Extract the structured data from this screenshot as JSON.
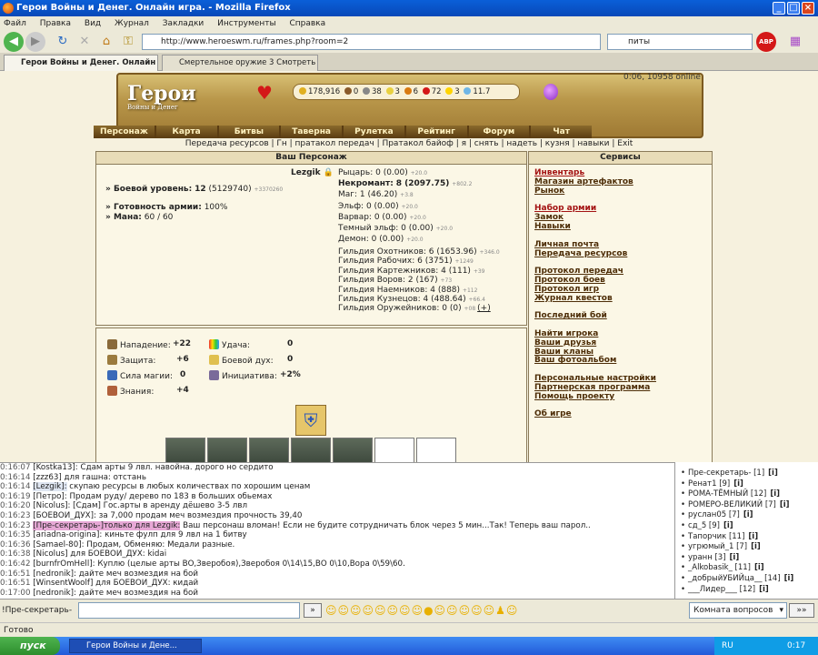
{
  "window": {
    "title": "Герои Войны и Денег. Онлайн игра. - Mozilla Firefox"
  },
  "menu": [
    "Файл",
    "Правка",
    "Вид",
    "Журнал",
    "Закладки",
    "Инструменты",
    "Справка"
  ],
  "nav": {
    "url": "http://www.heroeswm.ru/frames.php?room=2",
    "search": "питы"
  },
  "tabs": [
    "Герои Войны и Денег. Онлайн иг...",
    "Смертельное оружие 3 Смотреть Он..."
  ],
  "game": {
    "logo_title": "Герои",
    "logo_subtitle": "Войны и Денег",
    "resources": [
      "178,916",
      "0",
      "38",
      "3",
      "6",
      "72",
      "3",
      "11.7"
    ],
    "online": "0:06, 10958 online",
    "main_nav": [
      "Персонаж",
      "Карта",
      "Битвы",
      "Таверна",
      "Рулетка",
      "Рейтинг",
      "Форум",
      "Чат"
    ],
    "sub_nav": "Передача ресурсов | Гн | пратакол передач | Пратакол байоф | я | снять | надеть | кузня | навыки | Exit"
  },
  "character": {
    "panel_title": "Ваш Персонаж",
    "name": "Lezgik",
    "level_label": "» Боевой уровень:",
    "level_value": "12",
    "level_exp": "(5129740)",
    "level_bonus": "+3370260",
    "army_label": "» Готовность армии:",
    "army_value": "100%",
    "mana_label": "» Мана:",
    "mana_value": "60 / 60",
    "factions": [
      {
        "label": "Рыцарь:",
        "value": "0 (0.00)",
        "bonus": "+20.0"
      },
      {
        "label": "Некромант:",
        "value": "8 (2097.75)",
        "bonus": "+802.2"
      },
      {
        "label": "Маг:",
        "value": "1 (46.20)",
        "bonus": "+3.8"
      },
      {
        "label": "Эльф:",
        "value": "0 (0.00)",
        "bonus": "+20.0"
      },
      {
        "label": "Варвар:",
        "value": "0 (0.00)",
        "bonus": "+20.0"
      },
      {
        "label": "Темный эльф:",
        "value": "0 (0.00)",
        "bonus": "+20.0"
      },
      {
        "label": "Демон:",
        "value": "0 (0.00)",
        "bonus": "+20.0"
      }
    ],
    "guilds": [
      {
        "label": "Гильдия Охотников:",
        "value": "6 (1653.96)",
        "bonus": "+346.0"
      },
      {
        "label": "Гильдия Рабочих:",
        "value": "6 (3751)",
        "bonus": "+1249"
      },
      {
        "label": "Гильдия Картежников:",
        "value": "4 (111)",
        "bonus": "+39"
      },
      {
        "label": "Гильдия Воров:",
        "value": "2 (167)",
        "bonus": "+73"
      },
      {
        "label": "Гильдия Наемников:",
        "value": "4 (888)",
        "bonus": "+112"
      },
      {
        "label": "Гильдия Кузнецов:",
        "value": "4 (488.64)",
        "bonus": "+66.4"
      },
      {
        "label": "Гильдия Оружейников:",
        "value": "0 (0)",
        "bonus": "+08"
      }
    ],
    "guild_plus": "(+)"
  },
  "stats": [
    {
      "label": "Нападение:",
      "value": "+22",
      "icon": "sword-icon"
    },
    {
      "label": "Защита:",
      "value": "+6",
      "icon": "shield-icon"
    },
    {
      "label": "Сила магии:",
      "value": "0",
      "icon": "wand-icon"
    },
    {
      "label": "Знания:",
      "value": "+4",
      "icon": "book-icon"
    },
    {
      "label": "Удача:",
      "value": "0",
      "icon": "rainbow-icon"
    },
    {
      "label": "Боевой дух:",
      "value": "0",
      "icon": "wings-icon"
    },
    {
      "label": "Инициатива:",
      "value": "+2%",
      "icon": "hourglass-icon"
    }
  ],
  "services": {
    "title": "Сервисы",
    "groups": [
      [
        "Инвентарь",
        "Магазин артефактов",
        "Рынок"
      ],
      [
        "Набор армии",
        "Замок",
        "Навыки"
      ],
      [
        "Личная почта",
        "Передача ресурсов"
      ],
      [
        "Протокол передач",
        "Протокол боев",
        "Протокол игр",
        "Журнал квестов"
      ],
      [
        "Последний бой"
      ],
      [
        "Найти игрока",
        "Ваши друзья",
        "Ваши кланы",
        "Ваш фотоальбом"
      ],
      [
        "Персональные настройки",
        "Партнерская программа",
        "Помощь проекту"
      ],
      [
        "Об игре"
      ]
    ]
  },
  "chat": [
    {
      "time": "0:16:07",
      "nick": "[Kostka13]:",
      "text": " Сдам арты 9 лвл. навойна. дорого но сердито"
    },
    {
      "time": "0:16:14",
      "nick": "[zzz63]",
      "text": " для гашна: отстань"
    },
    {
      "time": "0:16:14",
      "nick": "[Lezgik]:",
      "text": " скупаю ресурсы в любых количествах по хорошим ценам"
    },
    {
      "time": "0:16:19",
      "nick": "[Петро]:",
      "text": " Продам руду/ дерево по 183 в больших обьемах"
    },
    {
      "time": "0:16:20",
      "nick": "[Nicolus]:",
      "text": " [Сдам] Гос.арты в аренду дёшево 3-5 лвл"
    },
    {
      "time": "0:16:23",
      "nick": "[БОЕВОЙ_ДУХ]:",
      "text": " за 7,000 продам меч возмездия прочность 39,40"
    },
    {
      "time": "0:16:23",
      "nick": "[Пре-секретарь-]только для Lezgik:",
      "text": " Ваш персонаш вломан! Если не будите сотрудничать блок через 5 мин...Так! Теперь ваш парол.."
    },
    {
      "time": "0:16:35",
      "nick": "[ariadna-origina]:",
      "text": " киньте фулп для 9 лвл на 1 битву"
    },
    {
      "time": "0:16:36",
      "nick": "[Samael-80]:",
      "text": " Продам, Обменяю: Медали разные."
    },
    {
      "time": "0:16:38",
      "nick": "[Nicolus]",
      "text": " для БОЕВОЙ_ДУХ: kidai"
    },
    {
      "time": "0:16:42",
      "nick": "[burnfrOmHell]:",
      "text": " Куплю (целые арты ВО,Зверобоя),Зверобоя 0\\14\\15,ВО 0\\10,Вора 0\\59\\60."
    },
    {
      "time": "0:16:51",
      "nick": "[nedronik]:",
      "text": " дайте меч возмездия на бой"
    },
    {
      "time": "0:16:51",
      "nick": "[WinsentWoolf]",
      "text": " для БОЕВОЙ_ДУХ: кидай"
    },
    {
      "time": "0:17:00",
      "nick": "[nedronik]:",
      "text": " дайте меч возмездия на бой"
    }
  ],
  "users": [
    "Пре-секретарь- [1]",
    "Ренат1 [9]",
    "РОМА-ТЁМНЫЙ [12]",
    "РОМЕРО-ВЕЛИКИЙ [7]",
    "руслан05 [7]",
    "сд_5 [9]",
    "Тапорчик [11]",
    "угрюмый_1 [7]",
    "уранн [3]",
    "_Alkobasik_ [11]",
    "_добрыйУБИЙца__ [14]",
    "___Лидер___ [12]"
  ],
  "user_info": "[i]",
  "chat_input": {
    "value": "!Пре-секретарь-",
    "send": "»",
    "room": "Комната вопросов",
    "room_btn": "»»"
  },
  "statusbar": "Готово",
  "taskbar": {
    "start": "пуск",
    "item": "Герои Войны и Дене...",
    "lang": "RU",
    "clock": "0:17"
  }
}
